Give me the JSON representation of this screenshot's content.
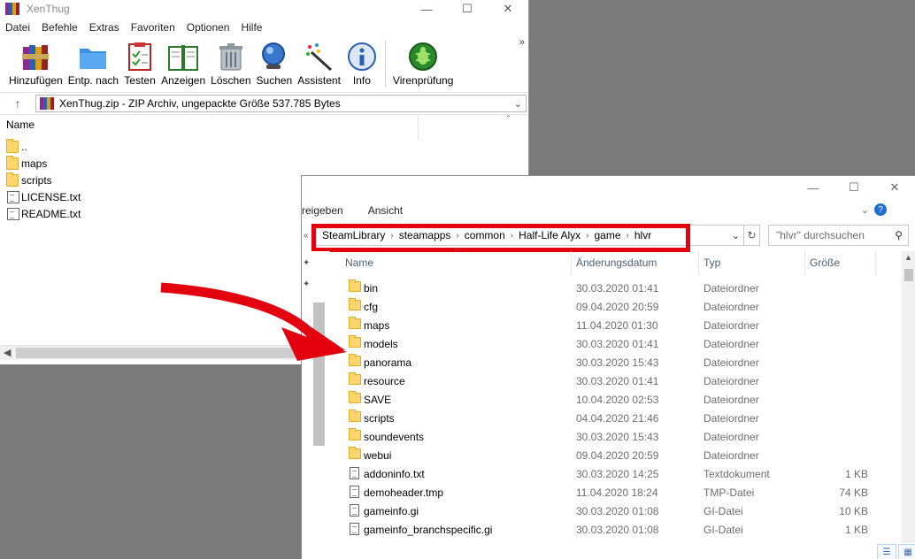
{
  "winrar": {
    "title": "XenThug",
    "menu": [
      "Datei",
      "Befehle",
      "Extras",
      "Favoriten",
      "Optionen",
      "Hilfe"
    ],
    "toolbar": {
      "add": "Hinzufügen",
      "extract": "Entp. nach",
      "test": "Testen",
      "view": "Anzeigen",
      "delete": "Löschen",
      "find": "Suchen",
      "wizard": "Assistent",
      "info": "Info",
      "virus": "Virenprüfung"
    },
    "address": "XenThug.zip - ZIP Archiv, ungepackte Größe 537.785 Bytes",
    "column_name": "Name",
    "files": [
      {
        "name": "..",
        "type": "folder"
      },
      {
        "name": "maps",
        "type": "folder"
      },
      {
        "name": "scripts",
        "type": "folder"
      },
      {
        "name": "LICENSE.txt",
        "type": "file"
      },
      {
        "name": "README.txt",
        "type": "file"
      }
    ],
    "icon_names": {
      "add": "books-archive-icon",
      "extract": "folder-extract-icon",
      "test": "checklist-icon",
      "view": "open-book-icon",
      "delete": "trash-can-icon",
      "find": "magnifier-icon",
      "wizard": "magic-wand-icon",
      "info": "info-icon",
      "virus": "bug-shield-icon"
    }
  },
  "explorer": {
    "ribbon": [
      "reigeben",
      "Ansicht"
    ],
    "breadcrumb": [
      "SteamLibrary",
      "steamapps",
      "common",
      "Half-Life Alyx",
      "game",
      "hlvr"
    ],
    "search_placeholder": "\"hlvr\" durchsuchen",
    "columns": {
      "name": "Name",
      "date": "Änderungsdatum",
      "type": "Typ",
      "size": "Größe"
    },
    "rows": [
      {
        "name": "bin",
        "date": "30.03.2020 01:41",
        "type": "Dateiordner",
        "size": "",
        "kind": "folder"
      },
      {
        "name": "cfg",
        "date": "09.04.2020 20:59",
        "type": "Dateiordner",
        "size": "",
        "kind": "folder"
      },
      {
        "name": "maps",
        "date": "11.04.2020 01:30",
        "type": "Dateiordner",
        "size": "",
        "kind": "folder"
      },
      {
        "name": "models",
        "date": "30.03.2020 01:41",
        "type": "Dateiordner",
        "size": "",
        "kind": "folder"
      },
      {
        "name": "panorama",
        "date": "30.03.2020 15:43",
        "type": "Dateiordner",
        "size": "",
        "kind": "folder"
      },
      {
        "name": "resource",
        "date": "30.03.2020 01:41",
        "type": "Dateiordner",
        "size": "",
        "kind": "folder"
      },
      {
        "name": "SAVE",
        "date": "10.04.2020 02:53",
        "type": "Dateiordner",
        "size": "",
        "kind": "folder"
      },
      {
        "name": "scripts",
        "date": "04.04.2020 21:46",
        "type": "Dateiordner",
        "size": "",
        "kind": "folder"
      },
      {
        "name": "soundevents",
        "date": "30.03.2020 15:43",
        "type": "Dateiordner",
        "size": "",
        "kind": "folder"
      },
      {
        "name": "webui",
        "date": "09.04.2020 20:59",
        "type": "Dateiordner",
        "size": "",
        "kind": "folder"
      },
      {
        "name": "addoninfo.txt",
        "date": "30.03.2020 14:25",
        "type": "Textdokument",
        "size": "1 KB",
        "kind": "file"
      },
      {
        "name": "demoheader.tmp",
        "date": "11.04.2020 18:24",
        "type": "TMP-Datei",
        "size": "74 KB",
        "kind": "file"
      },
      {
        "name": "gameinfo.gi",
        "date": "30.03.2020 01:08",
        "type": "GI-Datei",
        "size": "10 KB",
        "kind": "file"
      },
      {
        "name": "gameinfo_branchspecific.gi",
        "date": "30.03.2020 01:08",
        "type": "GI-Datei",
        "size": "1 KB",
        "kind": "file"
      }
    ]
  },
  "colors": {
    "highlight": "#e3000f",
    "arrow": "#e3000f"
  }
}
